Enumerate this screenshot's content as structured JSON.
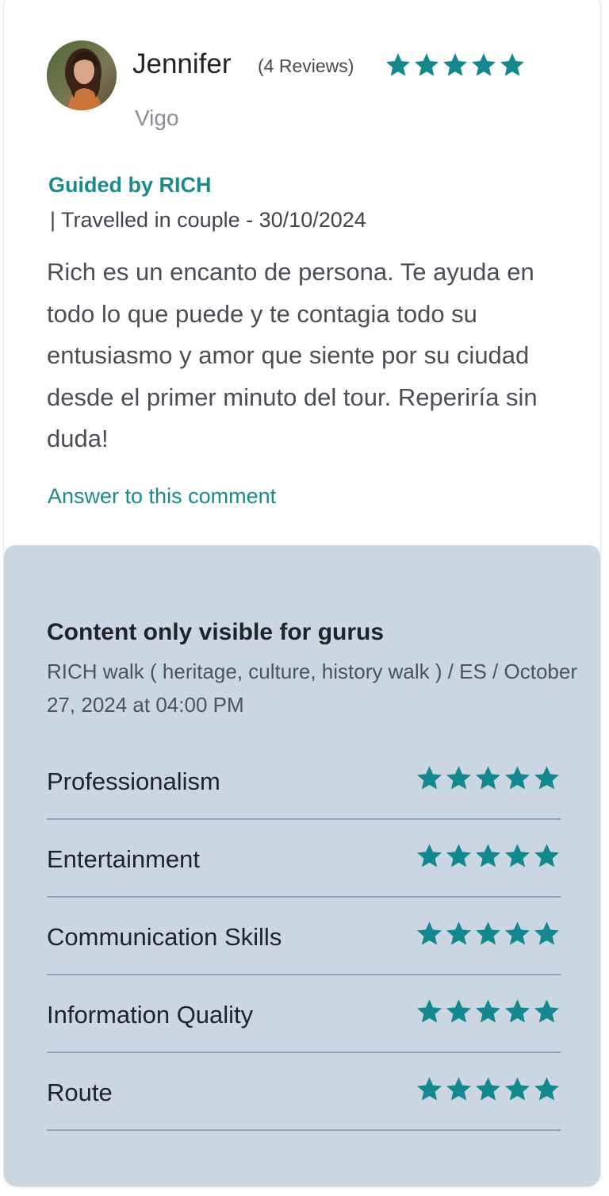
{
  "review": {
    "reviewer_name": "Jennifer",
    "reviews_count": "(4 Reviews)",
    "city": "Vigo",
    "rating": 5,
    "guided_by": "Guided by RICH",
    "travel_info": "| Travelled in couple - 30/10/2024",
    "text": "Rich es un encanto de persona. Te ayuda en todo lo que puede y te contagia todo su entusiasmo y amor que siente por su ciudad desde el primer minuto del tour. Reperiría sin duda!",
    "answer_link": "Answer to this comment"
  },
  "guru_section": {
    "title": "Content only visible for gurus",
    "tour_info": "RICH walk ( heritage, culture, history walk ) / ES / October 27, 2024 at 04:00 PM",
    "ratings": [
      {
        "label": "Professionalism",
        "stars": 5
      },
      {
        "label": "Entertainment",
        "stars": 5
      },
      {
        "label": "Communication Skills",
        "stars": 5
      },
      {
        "label": "Information Quality",
        "stars": 5
      },
      {
        "label": "Route",
        "stars": 5
      }
    ]
  },
  "colors": {
    "accent": "#1a8a8a",
    "star": "#13898f",
    "panel": "#cbd6e3",
    "divider": "#8fa2b8"
  },
  "icons": {
    "star": "star-icon"
  }
}
